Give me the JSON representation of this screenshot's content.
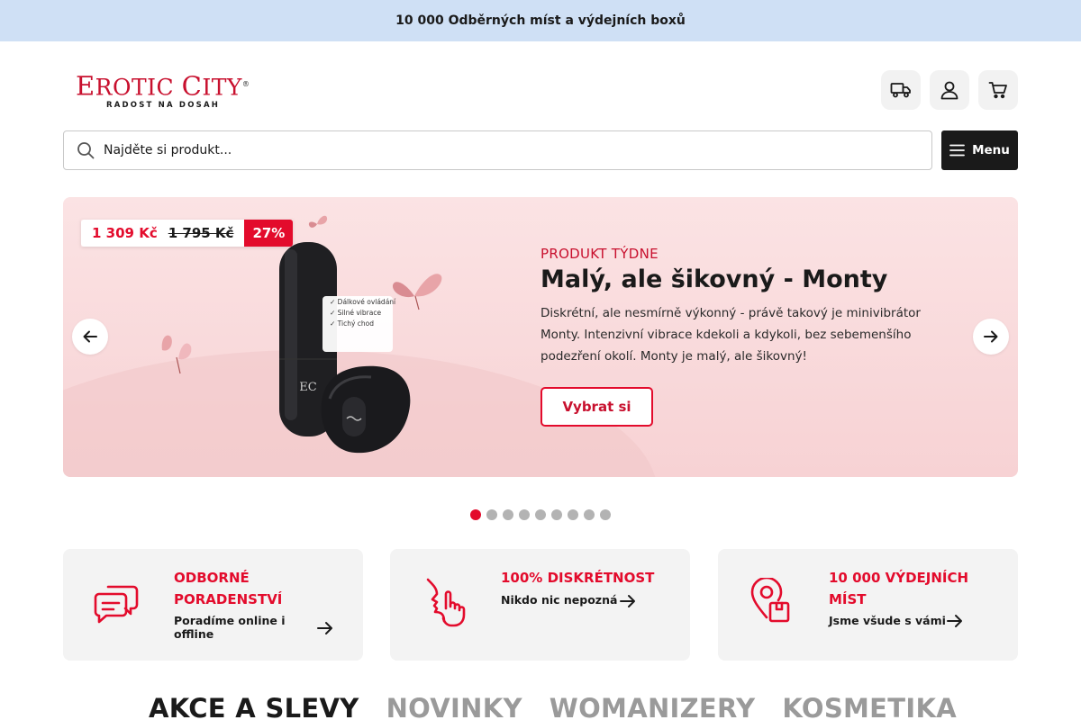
{
  "topbar": {
    "text": "10 000 Odběrných míst a výdejních boxů"
  },
  "logo": {
    "first_initial": "E",
    "first_rest": "ROTIC",
    "second_initial": "C",
    "second_rest": "ITY",
    "reg": "®",
    "tagline": "RADOST NA DOSAH"
  },
  "header_icons": [
    "truck-icon",
    "user-icon",
    "cart-icon"
  ],
  "search": {
    "placeholder": "Najděte si produkt..."
  },
  "menu": {
    "label": "Menu"
  },
  "hero": {
    "price_new": "1 309 Kč",
    "price_old": "1 795 Kč",
    "discount": "27%",
    "product_features": [
      "Dálkové ovládání",
      "Silné vibrace",
      "Tichý chod"
    ],
    "eyebrow": "PRODUKT TÝDNE",
    "title": "Malý, ale šikovný - Monty",
    "description": "Diskrétní, ale nesmírně výkonný - právě takový je minivibrátor Monty. Intenzivní vibrace kdekoli a kdykoli, bez sebemenšího podezření okolí. Monty je malý, ale šikovný!",
    "cta": "Vybrat si"
  },
  "carousel": {
    "slide_count": 9,
    "active_index": 0
  },
  "features": [
    {
      "title": "ODBORNÉ PORADENSTVÍ",
      "subtitle": "Poradíme online i offline",
      "icon": "chat-bubbles-icon"
    },
    {
      "title": "100% DISKRÉTNOST",
      "subtitle": "Nikdo nic nepozná",
      "icon": "silence-face-icon"
    },
    {
      "title": "10 000 VÝDEJNÍCH MÍST",
      "subtitle": "Jsme všude s vámi",
      "icon": "location-package-icon"
    }
  ],
  "tabs": [
    {
      "label": "AKCE A SLEVY",
      "active": true
    },
    {
      "label": "NOVINKY",
      "active": false
    },
    {
      "label": "WOMANIZERY",
      "active": false
    },
    {
      "label": "KOSMETIKA",
      "active": false
    }
  ],
  "colors": {
    "accent": "#e30b2c",
    "brand_red": "#c8102e",
    "topbar_bg": "#cfe0f5",
    "hero_bg": "#f7d2d4",
    "dark": "#1a1a1a"
  }
}
